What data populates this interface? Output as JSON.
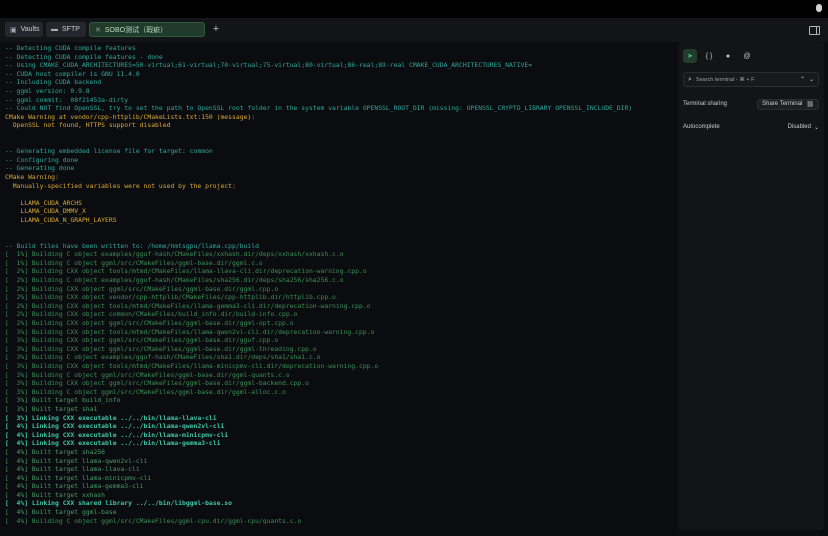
{
  "tabs": {
    "vaults": "Vaults",
    "sftp": "SFTP",
    "session": "SOBO测试（瑕疵）",
    "close": "✕",
    "add": "+"
  },
  "terminal": {
    "lines": [
      {
        "text": "-- Detecting CUDA compile features",
        "color": "teal"
      },
      {
        "text": "-- Detecting CUDA compile features - done",
        "color": "teal"
      },
      {
        "text": "-- Using CMAKE_CUDA_ARCHITECTURES=50-virtual;61-virtual;70-virtual;75-virtual;80-virtual;86-real;89-real CMAKE_CUDA_ARCHITECTURES_NATIVE=",
        "color": "teal"
      },
      {
        "text": "-- CUDA host compiler is GNU 11.4.0",
        "color": "teal"
      },
      {
        "text": "-- Including CUDA backend",
        "color": "teal"
      },
      {
        "text": "-- ggml version: 0.9.8",
        "color": "teal"
      },
      {
        "text": "-- ggml commit:  08f21453a-dirty",
        "color": "teal"
      },
      {
        "text": "-- Could NOT find OpenSSL, try to set the path to OpenSSL root folder in the system variable OPENSSL_ROOT_DIR (missing: OPENSSL_CRYPTO_LIBRARY OPENSSL_INCLUDE_DIR)",
        "color": "teal"
      },
      {
        "text": "CMake Warning at vendor/cpp-httplib/CMakeLists.txt:150 (message):",
        "color": "gold"
      },
      {
        "text": "  OpenSSL not found, HTTPS support disabled",
        "color": "gold"
      },
      {
        "text": "",
        "color": "teal"
      },
      {
        "text": "",
        "color": "teal"
      },
      {
        "text": "-- Generating embedded license file for target: common",
        "color": "teal"
      },
      {
        "text": "-- Configuring done",
        "color": "teal"
      },
      {
        "text": "-- Generating done",
        "color": "teal"
      },
      {
        "text": "CMake Warning:",
        "color": "gold"
      },
      {
        "text": "  Manually-specified variables were not used by the project:",
        "color": "gold"
      },
      {
        "text": "",
        "color": "gold"
      },
      {
        "text": "    LLAMA_CUDA_ARCHS",
        "color": "gold"
      },
      {
        "text": "    LLAMA_CUDA_DMMV_X",
        "color": "gold"
      },
      {
        "text": "    LLAMA_CUDA_N_GRAPH_LAYERS",
        "color": "gold"
      },
      {
        "text": "",
        "color": "teal"
      },
      {
        "text": "",
        "color": "teal"
      },
      {
        "text": "-- Build files have been written to: /home/hmtsgpu/llama.cpp/build",
        "color": "teal"
      },
      {
        "text": "[  1%] Building C object examples/gguf-hash/CMakeFiles/xxhash.dir/deps/xxhash/xxhash.c.o",
        "color": "green"
      },
      {
        "text": "[  1%] Building C object ggml/src/CMakeFiles/ggml-base.dir/ggml.c.o",
        "color": "green"
      },
      {
        "text": "[  2%] Building CXX object tools/mtmd/CMakeFiles/llama-llava-cli.dir/deprecation-warning.cpp.o",
        "color": "green"
      },
      {
        "text": "[  2%] Building C object examples/gguf-hash/CMakeFiles/sha256.dir/deps/sha256/sha256.c.o",
        "color": "green"
      },
      {
        "text": "[  2%] Building CXX object ggml/src/CMakeFiles/ggml-base.dir/ggml.cpp.o",
        "color": "green"
      },
      {
        "text": "[  2%] Building CXX object vendor/cpp-httplib/CMakeFiles/cpp-httplib.dir/httplib.cpp.o",
        "color": "green"
      },
      {
        "text": "[  2%] Building CXX object tools/mtmd/CMakeFiles/llama-gemma3-cli.dir/deprecation-warning.cpp.o",
        "color": "green"
      },
      {
        "text": "[  2%] Building CXX object common/CMakeFiles/build_info.dir/build-info.cpp.o",
        "color": "green"
      },
      {
        "text": "[  2%] Building CXX object ggml/src/CMakeFiles/ggml-base.dir/ggml-opt.cpp.o",
        "color": "green"
      },
      {
        "text": "[  3%] Building CXX object tools/mtmd/CMakeFiles/llama-qwen2vl-cli.dir/deprecation-warning.cpp.o",
        "color": "green"
      },
      {
        "text": "[  3%] Building CXX object ggml/src/CMakeFiles/ggml-base.dir/gguf.cpp.o",
        "color": "green"
      },
      {
        "text": "[  3%] Building CXX object ggml/src/CMakeFiles/ggml-base.dir/ggml-threading.cpp.o",
        "color": "green"
      },
      {
        "text": "[  3%] Building C object examples/gguf-hash/CMakeFiles/sha1.dir/deps/sha1/sha1.c.o",
        "color": "green"
      },
      {
        "text": "[  3%] Building CXX object tools/mtmd/CMakeFiles/llama-minicpmv-cli.dir/deprecation-warning.cpp.o",
        "color": "green"
      },
      {
        "text": "[  3%] Building C object ggml/src/CMakeFiles/ggml-base.dir/ggml-quants.c.o",
        "color": "green"
      },
      {
        "text": "[  3%] Building CXX object ggml/src/CMakeFiles/ggml-base.dir/ggml-backend.cpp.o",
        "color": "green"
      },
      {
        "text": "[  3%] Building C object ggml/src/CMakeFiles/ggml-base.dir/ggml-alloc.c.o",
        "color": "green"
      },
      {
        "text": "[  3%] Built target build_info",
        "color": "green2"
      },
      {
        "text": "[  3%] Built target sha1",
        "color": "green2"
      },
      {
        "text": "[  3%] Linking CXX executable ../../bin/llama-llava-cli",
        "color": "bold"
      },
      {
        "text": "[  4%] Linking CXX executable ../../bin/llama-qwen2vl-cli",
        "color": "bold"
      },
      {
        "text": "[  4%] Linking CXX executable ../../bin/llama-minicpmv-cli",
        "color": "bold"
      },
      {
        "text": "[  4%] Linking CXX executable ../../bin/llama-gemma3-cli",
        "color": "bold"
      },
      {
        "text": "[  4%] Built target sha256",
        "color": "green2"
      },
      {
        "text": "[  4%] Built target llama-qwen2vl-cli",
        "color": "green2"
      },
      {
        "text": "[  4%] Built target llama-llava-cli",
        "color": "green2"
      },
      {
        "text": "[  4%] Built target llama-minicpmv-cli",
        "color": "green2"
      },
      {
        "text": "[  4%] Built target llama-gemma3-cli",
        "color": "green2"
      },
      {
        "text": "[  4%] Built target xxhash",
        "color": "green2"
      },
      {
        "text": "[  4%] Linking CXX shared library ../../bin/libggml-base.so",
        "color": "bold"
      },
      {
        "text": "[  4%] Built target ggml-base",
        "color": "green2"
      },
      {
        "text": "[  4%] Building C object ggml/src/CMakeFiles/ggml-cpu.dir/ggml-cpu/quants.c.o",
        "color": "green"
      }
    ]
  },
  "sidebar": {
    "search_placeholder": "Search terminal - ⌘ + F",
    "terminal_sharing_label": "Terminal sharing",
    "share_terminal_label": "Share Terminal",
    "autocomplete_label": "Autocomplete",
    "autocomplete_value": "Disabled"
  },
  "colors": {
    "teal": "#2fa79b",
    "gold": "#d9a937",
    "green": "#3c8f56",
    "green2": "#4a9a67",
    "bold": "#3fc6a5",
    "active_tab": "#213b2a"
  },
  "icons": [
    "vault-icon",
    "folder-icon",
    "close-icon",
    "plus-icon",
    "panel-toggle-icon",
    "send-icon",
    "braces-icon",
    "info-icon",
    "at-icon",
    "search-icon",
    "chevron-up-icon",
    "chevron-down-icon",
    "link-icon"
  ]
}
